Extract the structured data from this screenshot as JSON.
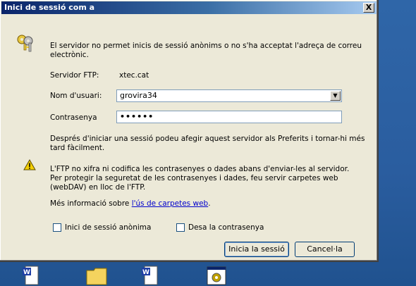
{
  "dialog": {
    "title": "Inici de sessió com a",
    "close_label": "X",
    "intro_text_line1": "El servidor no permet inicis de sessió anònims o no s'ha acceptat l'adreça de correu",
    "intro_text_line2": "electrònic.",
    "server_label": "Servidor FTP:",
    "server_value": "xtec.cat",
    "user_label": "Nom d'usuari:",
    "user_value": "grovira34",
    "password_label": "Contrasenya",
    "password_value": "••••••",
    "after_login_line1": "Després d'iniciar una sessió podeu afegir aquest servidor als Preferits i tornar-hi més",
    "after_login_line2": "tard fàcilment.",
    "warning_line1": "L'FTP no xifra ni codifica les contrasenyes o dades abans d'enviar-les al servidor.",
    "warning_line2": "Per protegir la seguretat de les contrasenyes i dades, feu servir carpetes web",
    "warning_line3": "(webDAV) en lloc de l'FTP.",
    "more_info_prefix": "Més informació sobre ",
    "more_info_link": "l'ús de carpetes web",
    "more_info_suffix": ".",
    "anon_checkbox_label": "Inici de sessió anònima",
    "save_password_label": "Desa la contrasenya",
    "login_button": "Inicia la sessió",
    "cancel_button": "Cancel·la"
  },
  "colors": {
    "titlebar_start": "#0a246a",
    "titlebar_end": "#a6caf0",
    "dialog_bg": "#ece9d8",
    "desktop": "#2f66a8",
    "link": "#0000cc"
  }
}
